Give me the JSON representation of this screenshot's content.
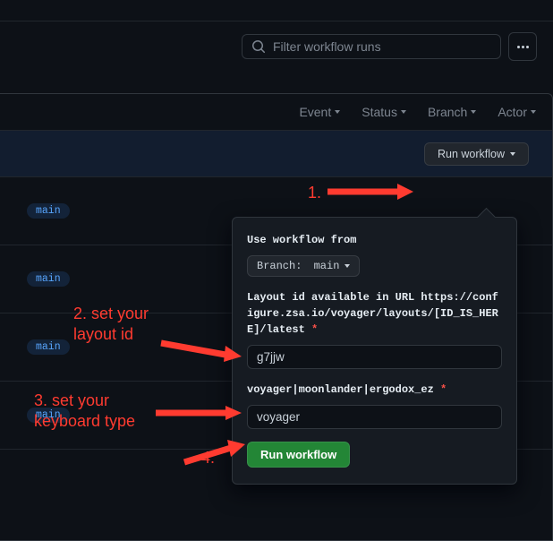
{
  "search": {
    "placeholder": "Filter workflow runs"
  },
  "filters": {
    "event": "Event",
    "status": "Status",
    "branch": "Branch",
    "actor": "Actor"
  },
  "run_button": "Run workflow",
  "branch_tags": [
    "main",
    "main",
    "main",
    "main"
  ],
  "popover": {
    "use_label": "Use workflow from",
    "branch_prefix": "Branch: ",
    "branch_value": "main",
    "layout_label": "Layout id available in URL https://configure.zsa.io/voyager/layouts/[ID_IS_HERE]/latest",
    "layout_value": "g7jjw",
    "keyboard_label": "voyager|moonlander|ergodox_ez",
    "keyboard_value": "voyager",
    "submit": "Run workflow"
  },
  "annotations": {
    "a1": "1.",
    "a2": "2. set your\nlayout id",
    "a3": "3. set your\nkeyboard type",
    "a4": "4."
  }
}
